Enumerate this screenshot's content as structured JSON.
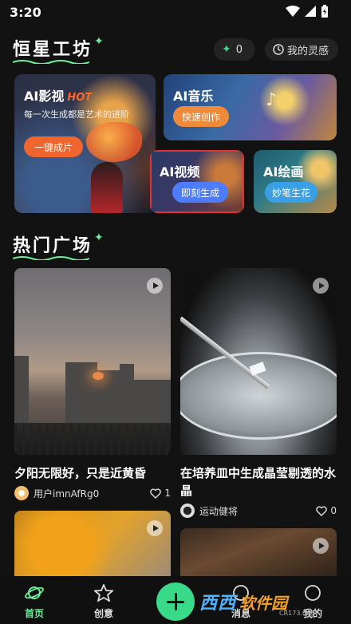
{
  "status_bar": {
    "time": "3:20"
  },
  "header": {
    "title": "恒星工坊",
    "credits": "0",
    "inspiration_label": "我的灵感"
  },
  "features": {
    "film": {
      "title": "AI影视",
      "badge": "HOT",
      "subtitle": "每一次生成都是艺术的进阶",
      "button": "一键成片"
    },
    "music": {
      "title": "AI音乐",
      "button": "快速创作"
    },
    "video": {
      "title": "AI视频",
      "button": "即刻生成"
    },
    "paint": {
      "title": "AI绘画",
      "button": "妙笔生花"
    }
  },
  "hot_section": {
    "title": "热门广场"
  },
  "feed": [
    {
      "caption": "夕阳无限好，只是近黄昏",
      "user": "用户imnAfRg0",
      "likes": "1"
    },
    {
      "caption": "在培养皿中生成晶莹剔透的水晶",
      "user": "运动健将",
      "likes": "0"
    }
  ],
  "nav": {
    "home": "首页",
    "create": "创意",
    "messages": "消息",
    "me": "我的"
  },
  "watermark": {
    "logo": "西西",
    "brand": "软件园",
    "url": "CR173.COM"
  },
  "colors": {
    "accent": "#39d98a",
    "film_button": "#f0642e",
    "music_button": "#f08a3b",
    "video_button": "#4d7cff",
    "paint_button": "#3aa0e6",
    "highlight": "#e33030"
  }
}
